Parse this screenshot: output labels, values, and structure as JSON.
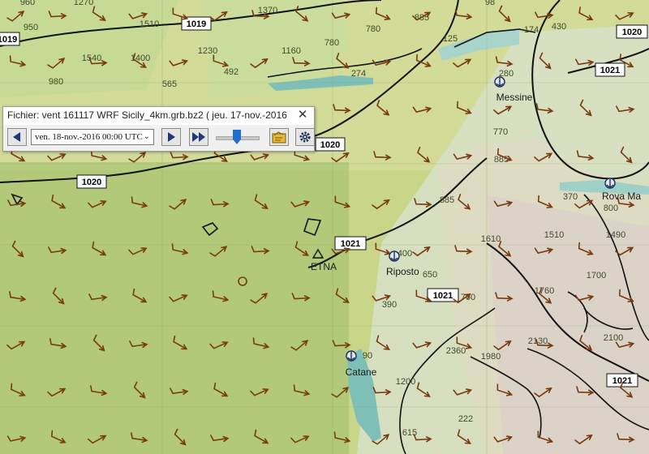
{
  "window": {
    "title": "Fichier: vent 161117 WRF Sicily_4km.grb.bz2 ( jeu. 17-nov.-2016 ...",
    "close_label": "✕"
  },
  "toolbar": {
    "date_value": "ven. 18-nov.-2016 00:00  UTC",
    "slider_fraction": 0.5,
    "icons": [
      "prev-record-icon",
      "next-record-icon",
      "fast-forward-icon",
      "time-slider",
      "load-file-icon",
      "settings-gear-icon"
    ]
  },
  "map": {
    "isobar_labels": [
      "1019",
      "1019",
      "1020",
      "1020",
      "1020",
      "1021",
      "1021",
      "1021",
      "1021"
    ],
    "elevation_labels": [
      "960",
      "1270",
      "1370",
      "885",
      "98",
      "174",
      "430",
      "950",
      "1510",
      "780",
      "780",
      "125",
      "1540",
      "1400",
      "1230",
      "1160",
      "980",
      "565",
      "492",
      "274",
      "280",
      "770",
      "885",
      "370",
      "885",
      "800",
      "1490",
      "1610",
      "1510",
      "400",
      "650",
      "1760",
      "1700",
      "390",
      "760",
      "2100",
      "90",
      "2360",
      "1980",
      "2130",
      "1200",
      "222",
      "615"
    ],
    "places": [
      "Messine",
      "Rova Ma",
      "ETNA",
      "Riposto",
      "Catane"
    ],
    "colors": {
      "land_base": "#c9d68a",
      "sea": "#7ec0b8",
      "wind_arrow": "#7a3a10",
      "isobar": "#111111",
      "label_box": "#ffffff"
    }
  }
}
